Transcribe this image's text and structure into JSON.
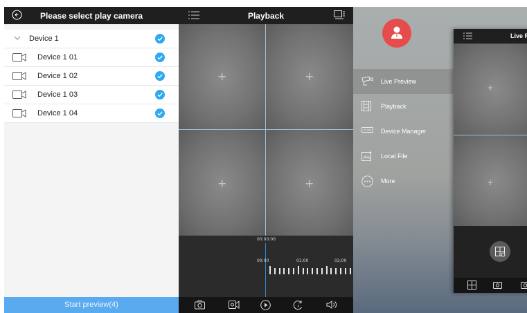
{
  "camera_select": {
    "title": "Please select play camera",
    "device": {
      "label": "Device 1",
      "checked": true
    },
    "channels": [
      {
        "label": "Device 1 01",
        "checked": true
      },
      {
        "label": "Device 1 02",
        "checked": true
      },
      {
        "label": "Device 1 03",
        "checked": true
      },
      {
        "label": "Device 1 04",
        "checked": true
      }
    ],
    "start_button": "Start preview(4)",
    "accent_color": "#2fa9f2",
    "button_color": "#5aaaf0"
  },
  "playback": {
    "title": "Playback",
    "current_time": "00:00:00",
    "time_labels": [
      "00:00",
      "01:00",
      "02:00"
    ],
    "toolbar_icons": [
      "camera-icon",
      "video-record-icon",
      "play-icon",
      "speed-icon",
      "volume-icon"
    ],
    "cursor_color": "#2f8ad8"
  },
  "side_menu": {
    "items": [
      {
        "label": "Live Preview",
        "icon": "live-preview-icon",
        "active": true
      },
      {
        "label": "Playback",
        "icon": "playback-icon",
        "active": false
      },
      {
        "label": "Device Manager",
        "icon": "device-manager-icon",
        "active": false
      },
      {
        "label": "Local File",
        "icon": "local-file-icon",
        "active": false
      },
      {
        "label": "More",
        "icon": "more-icon",
        "active": false
      }
    ],
    "avatar_color": "#e64c4c",
    "peek_title": "Live P",
    "peek_toolbar_icons": [
      "grid-icon",
      "camera-icon",
      "camera-icon"
    ]
  }
}
